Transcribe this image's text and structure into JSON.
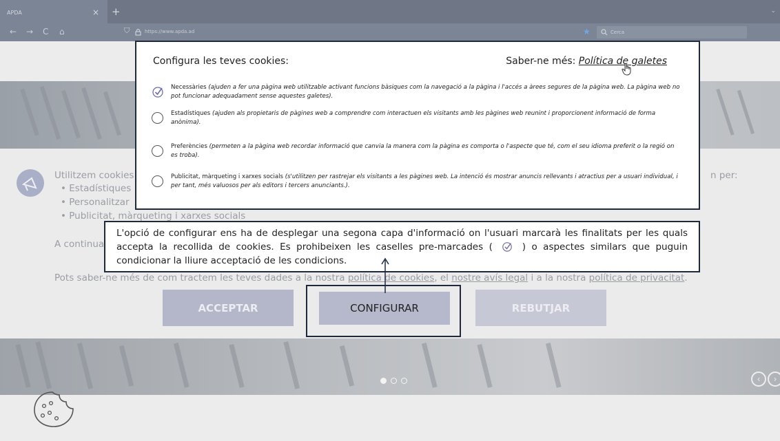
{
  "browser": {
    "tab_title": "APDA",
    "tab_close": "×",
    "new_tab": "+",
    "tab_list": "⌄",
    "nav": {
      "back": "←",
      "forward": "→",
      "reload": "C",
      "home": "⌂"
    },
    "url": "https://www.apda.ad",
    "search_placeholder": "Cerca"
  },
  "modal": {
    "title": "Configura les teves cookies:",
    "more_prefix": "Saber-ne més: ",
    "more_link": "Política de galetes",
    "options": [
      {
        "label": "Necessàries",
        "desc": "(ajuden a fer una pàgina web utilitzable activant funcions bàsiques com la navegació a la pàgina i l'accés a àrees segures de la pàgina web. La pàgina web no pot funcionar adequadament sense aquestes galetes).",
        "checked": true
      },
      {
        "label": "Estadístiques",
        "desc": "(ajuden als propietaris de pàgines web a comprendre com interactuen els visitants amb les pàgines web reunint i proporcionent informació de forma anònima).",
        "checked": false
      },
      {
        "label": "Preferències",
        "desc": "(permeten a la pàgina web recordar informació que canvia la manera com la pàgina es comporta o l'aspecte que té, com el seu idioma preferit o la regió on es troba).",
        "checked": false
      },
      {
        "label": "Publicitat, màrqueting i xarxes socials",
        "desc": "(s'utilitzen per rastrejar els visitants a les pàgines web. La intenció és mostrar anuncis rellevants i atractius per a usuari individual, i per tant, més valuosos per als editors i tercers anunciants.).",
        "checked": false
      }
    ]
  },
  "background": {
    "intro": "Utilitzem cookies a",
    "intro_end": "n per:",
    "bullets": [
      "Estadístiques",
      "Personalitzar",
      "Publicitat, màrqueting i xarxes socials"
    ],
    "continue": "A continua",
    "more_prefix": "Pots saber-ne més de com tractem les teves dades a la nostra ",
    "link_cookies": "política de cookies",
    "sep1": ", el ",
    "link_legal": "nostre avís legal",
    "sep2": " i a la nostra ",
    "link_privacy": "política de privacitat",
    "end": ".",
    "accept": "ACCEPTAR",
    "configure": "CONFIGURAR",
    "reject": "REBUTJAR"
  },
  "annotation": {
    "text_before": "L'opció de configurar ens ha de desplegar una segona capa d'informació on l'usuari marcarà les finalitats per les quals accepta la recollida de cookies. Es prohibeixen les caselles pre-marcades (",
    "text_after": ") o aspectes similars que puguin condicionar la lliure acceptació de les condicions."
  },
  "colors": {
    "border": "#1e2a3c",
    "check": "#6b6fa8",
    "accept_bg": "#b4b6c9"
  }
}
